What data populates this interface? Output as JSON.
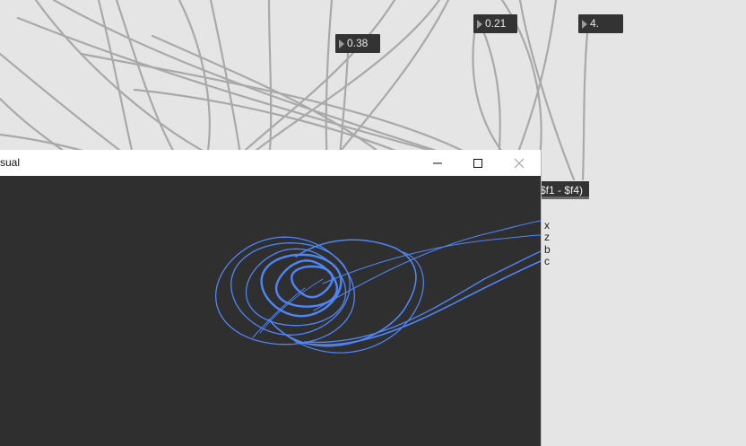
{
  "patch": {
    "number_boxes": [
      {
        "value": "0.38"
      },
      {
        "value": "0.21"
      },
      {
        "value": "4."
      }
    ],
    "expression": "$f1 - $f4)",
    "outlet_labels": [
      "x",
      "z",
      "b",
      "c"
    ]
  },
  "window": {
    "title": "sual",
    "minimize_icon": "minimize-icon",
    "maximize_icon": "maximize-icon",
    "close_icon": "close-icon"
  },
  "colors": {
    "patch_background": "#e5e5e5",
    "patch_cord": "#a9a9a9",
    "number_box": "#333333",
    "plot_background": "#2f2f2f",
    "attractor_trace": "#4f86f7"
  }
}
